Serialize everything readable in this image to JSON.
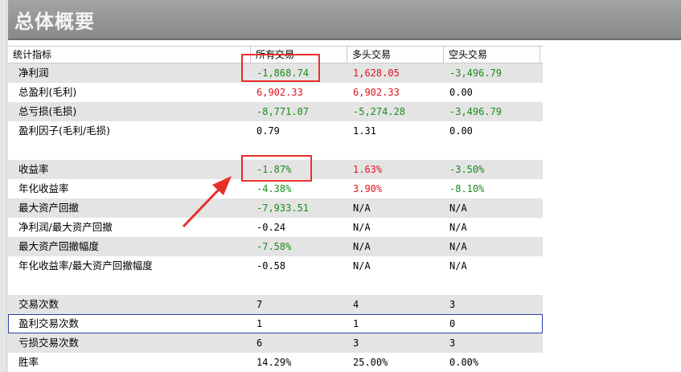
{
  "title": "总体概要",
  "headers": [
    "统计指标",
    "所有交易",
    "多头交易",
    "空头交易"
  ],
  "groups": [
    [
      {
        "label": "净利润",
        "all": "-1,868.74",
        "long": "1,628.05",
        "short": "-3,496.79",
        "c": [
          "green",
          "red",
          "green"
        ]
      },
      {
        "label": "总盈利(毛利)",
        "all": "6,902.33",
        "long": "6,902.33",
        "short": "0.00",
        "c": [
          "red",
          "red",
          ""
        ]
      },
      {
        "label": "总亏损(毛损)",
        "all": "-8,771.07",
        "long": "-5,274.28",
        "short": "-3,496.79",
        "c": [
          "green",
          "green",
          "green"
        ]
      },
      {
        "label": "盈利因子(毛利/毛损)",
        "all": "0.79",
        "long": "1.31",
        "short": "0.00",
        "c": [
          "",
          "",
          ""
        ]
      }
    ],
    [
      {
        "label": "收益率",
        "all": "-1.87%",
        "long": "1.63%",
        "short": "-3.50%",
        "c": [
          "green",
          "red",
          "green"
        ]
      },
      {
        "label": "年化收益率",
        "all": "-4.38%",
        "long": "3.90%",
        "short": "-8.10%",
        "c": [
          "green",
          "red",
          "green"
        ]
      },
      {
        "label": "最大资产回撤",
        "all": "-7,933.51",
        "long": "N/A",
        "short": "N/A",
        "c": [
          "green",
          "",
          ""
        ]
      },
      {
        "label": "净利润/最大资产回撤",
        "all": "-0.24",
        "long": "N/A",
        "short": "N/A",
        "c": [
          "",
          "",
          ""
        ]
      },
      {
        "label": "最大资产回撤幅度",
        "all": "-7.58%",
        "long": "N/A",
        "short": "N/A",
        "c": [
          "green",
          "",
          ""
        ]
      },
      {
        "label": "年化收益率/最大资产回撤幅度",
        "all": "-0.58",
        "long": "N/A",
        "short": "N/A",
        "c": [
          "",
          "",
          ""
        ]
      }
    ],
    [
      {
        "label": "交易次数",
        "all": "7",
        "long": "4",
        "short": "3",
        "c": [
          "",
          "",
          ""
        ]
      },
      {
        "label": "盈利交易次数",
        "all": "1",
        "long": "1",
        "short": "0",
        "c": [
          "",
          "",
          ""
        ],
        "selected": true
      },
      {
        "label": "亏损交易次数",
        "all": "6",
        "long": "3",
        "short": "3",
        "c": [
          "",
          "",
          ""
        ]
      },
      {
        "label": "胜率",
        "all": "14.29%",
        "long": "25.00%",
        "short": "0.00%",
        "c": [
          "",
          "",
          ""
        ]
      }
    ]
  ]
}
